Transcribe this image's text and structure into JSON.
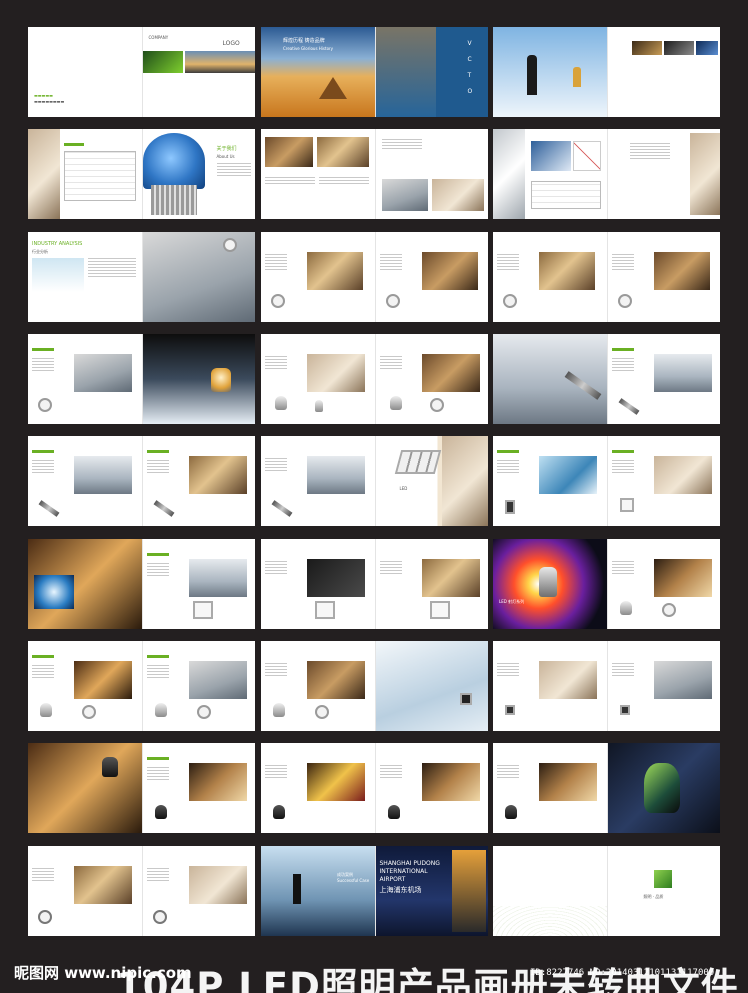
{
  "brochure": {
    "cover": {
      "logo_text": "LOGO",
      "company_text": "COMPANY"
    },
    "vision_spread": {
      "headline": "辉煌历程 铸造品牌",
      "subline": "Creative Glorious History",
      "letters": [
        "V",
        "C",
        "T",
        "O"
      ]
    },
    "about_spread": {
      "title_cn": "关于我们",
      "title_en": "About Us"
    },
    "industry_spread": {
      "title_en": "INDUSTRY ANALYSIS",
      "title_cn": "行业分析"
    },
    "product_label": "LED",
    "led_series_label": "LED 射灯系列",
    "airport_spread": {
      "case_cn": "成功案例",
      "case_en": "Successful Case",
      "name_en_1": "SHANGHAI PUDONG",
      "name_en_2": "INTERNATIONAL",
      "name_en_3": "AIRPORT",
      "name_cn": "上海浦东机场"
    },
    "logo_page": {
      "tagline": "照明 · 品质"
    }
  },
  "watermark": {
    "site": "昵图网 www.nipic.com",
    "title": "104P LED照明产品画册未转曲文件",
    "id_text": "ID:8227746 NO:20140312101131117000"
  },
  "colors": {
    "background": "#231f20",
    "accent_green": "#6ab023"
  }
}
